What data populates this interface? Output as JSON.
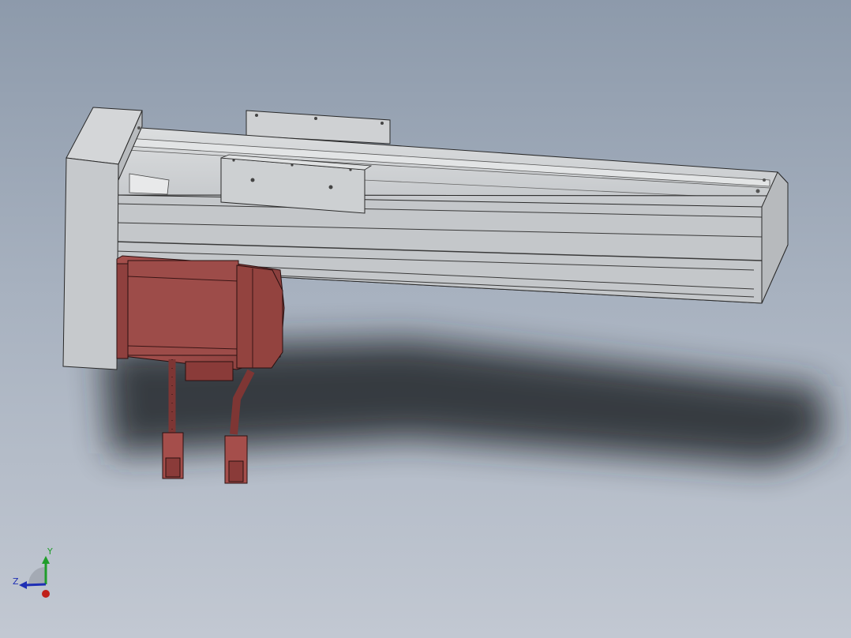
{
  "viewport": {
    "background_top": "#8d9aab",
    "background_bottom": "#c2c8d2"
  },
  "model": {
    "parts": [
      "linear-actuator-rail",
      "end-block",
      "carriage",
      "servo-motor",
      "motor-cables",
      "connectors"
    ],
    "colors": {
      "rail": "#d2d4d6",
      "rail_shade": "#b9bcc0",
      "end_block": "#c9cbce",
      "motor": "#9c4a48",
      "motor_shade": "#7e3634",
      "edge": "#2a2a2a",
      "shadow": "#2c2f33"
    }
  },
  "triad": {
    "y_label": "Y",
    "z_label": "Z",
    "icon": "coordinate-triad-icon",
    "colors": {
      "y": "#1f9d2a",
      "z": "#1f2fb4",
      "x": "#c0201a"
    }
  }
}
